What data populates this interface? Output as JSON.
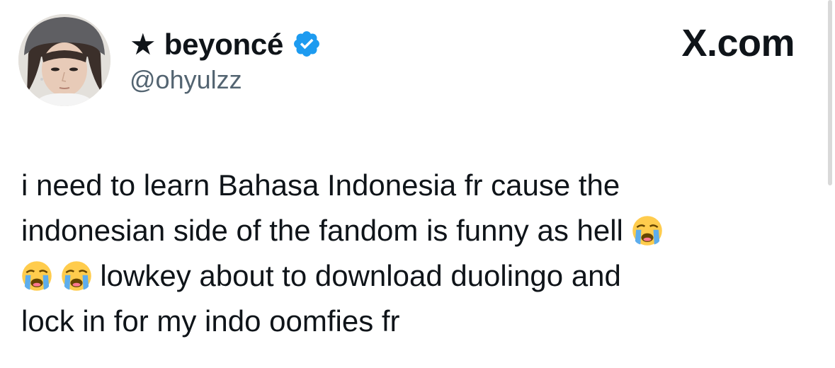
{
  "account": {
    "display_name": "★ beyoncé",
    "handle": "@ohyulzz",
    "verified": true,
    "verified_color": "#1d9bf0"
  },
  "site": {
    "label": "X.com"
  },
  "tweet": {
    "line1": "i need to learn Bahasa Indonesia fr cause the",
    "line2": "indonesian side of the fandom is funny as hell",
    "line3": "lowkey about to download duolingo and",
    "line4": "lock in for my indo oomfies fr",
    "emoji_name": "loudly-crying-face-emoji"
  },
  "colors": {
    "text": "#0f1419",
    "secondary_text": "#536471"
  }
}
